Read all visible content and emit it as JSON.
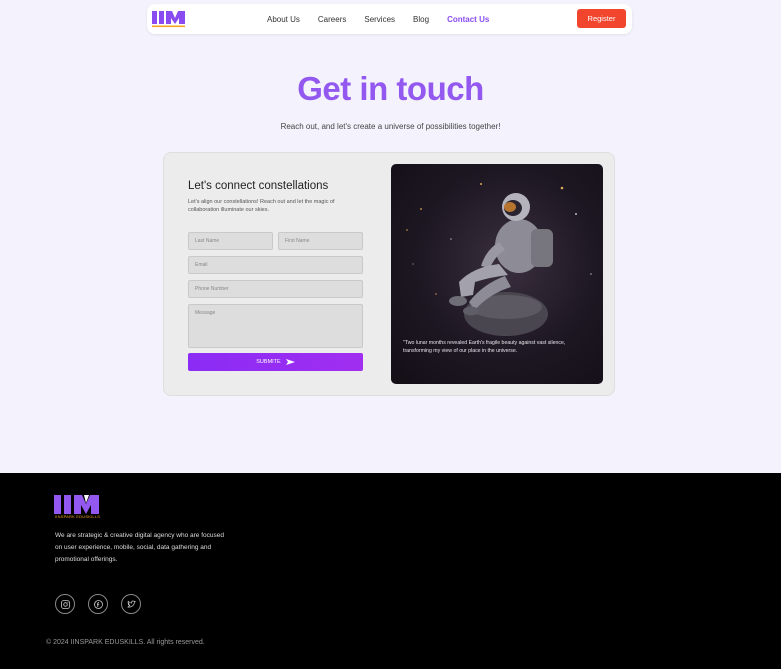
{
  "nav": {
    "links": [
      "About Us",
      "Careers",
      "Services",
      "Blog",
      "Contact Us"
    ],
    "active": "Contact Us",
    "register_label": "Register",
    "logo_icon": "iinspark-logo-icon"
  },
  "hero": {
    "title": "Get in touch",
    "subtitle": "Reach out, and let's create a universe of possibilities together!"
  },
  "form": {
    "title": "Let's connect constellations",
    "description": "Let's align our constellations! Reach out and let the magic of collaboration illuminate our skies.",
    "last_name_placeholder": "Last Name",
    "first_name_placeholder": "First Name",
    "email_placeholder": "Email",
    "phone_placeholder": "Phone Number",
    "message_placeholder": "Message",
    "submit_label": "SUBMITE",
    "submit_icon": "send-icon"
  },
  "photo": {
    "quote": "\"Two lunar months revealed Earth's fragile beauty against vast silence, transforming my view of our place in the universe."
  },
  "footer": {
    "brand": "IINSPARK EDUSKILLS",
    "description": "We are strategic & creative digital agency who are focused on user experience, mobile, social, data gathering and promotional offerings.",
    "social": [
      "instagram-icon",
      "facebook-icon",
      "twitter-icon"
    ],
    "copyright": "© 2024 IINSPARK EDUSKILLS. All rights reserved."
  },
  "colors": {
    "accent": "#9258f0",
    "register": "#f2452e",
    "submit": "#8a2cf5",
    "footer_bg": "#000000",
    "page_bg": "#f4f3fd"
  }
}
